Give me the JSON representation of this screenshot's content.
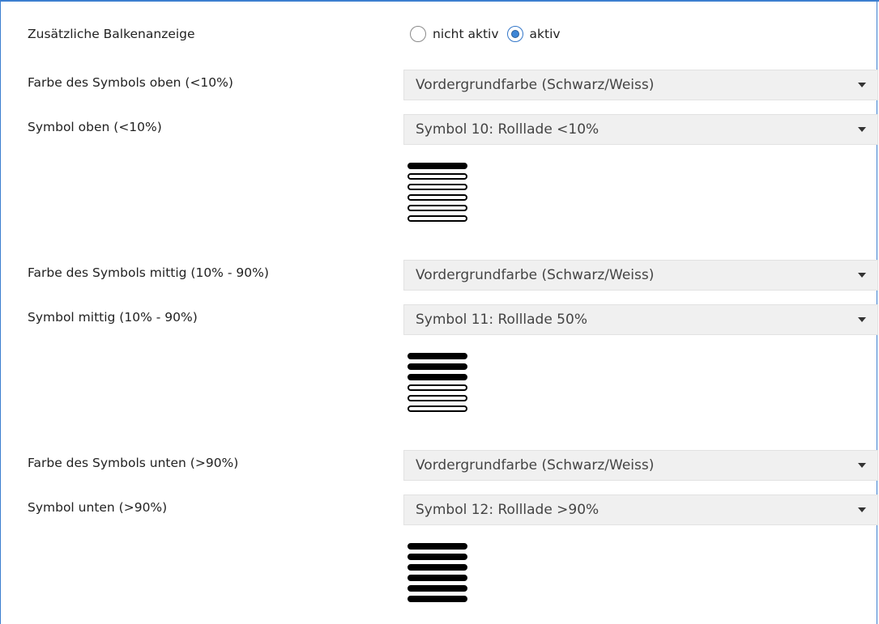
{
  "rows": {
    "bar_display_label": "Zusätzliche Balkenanzeige",
    "radio_inactive_label": "nicht aktiv",
    "radio_active_label": "aktiv",
    "radio_selected": "aktiv",
    "color_top_label": "Farbe des Symbols oben (<10%)",
    "color_top_value": "Vordergrundfarbe (Schwarz/Weiss)",
    "symbol_top_label": "Symbol oben (<10%)",
    "symbol_top_value": "Symbol 10: Rolllade <10%",
    "color_mid_label": "Farbe des Symbols mittig (10% - 90%)",
    "color_mid_value": "Vordergrundfarbe (Schwarz/Weiss)",
    "symbol_mid_label": "Symbol mittig (10% - 90%)",
    "symbol_mid_value": "Symbol 11: Rolllade 50%",
    "color_bottom_label": "Farbe des Symbols unten (>90%)",
    "color_bottom_value": "Vordergrundfarbe (Schwarz/Weiss)",
    "symbol_bottom_label": "Symbol unten (>90%)",
    "symbol_bottom_value": "Symbol 12: Rolllade >90%"
  },
  "icons": {
    "top": {
      "name": "shutter-closed-10-icon",
      "filled_slats": 1,
      "total_slats": 6
    },
    "mid": {
      "name": "shutter-half-50-icon",
      "filled_slats": 3,
      "total_slats": 6
    },
    "bottom": {
      "name": "shutter-open-90-icon",
      "filled_slats": 6,
      "total_slats": 6
    }
  },
  "colors": {
    "accent": "#3c7fd0",
    "select_bg": "#f0f0f0"
  }
}
